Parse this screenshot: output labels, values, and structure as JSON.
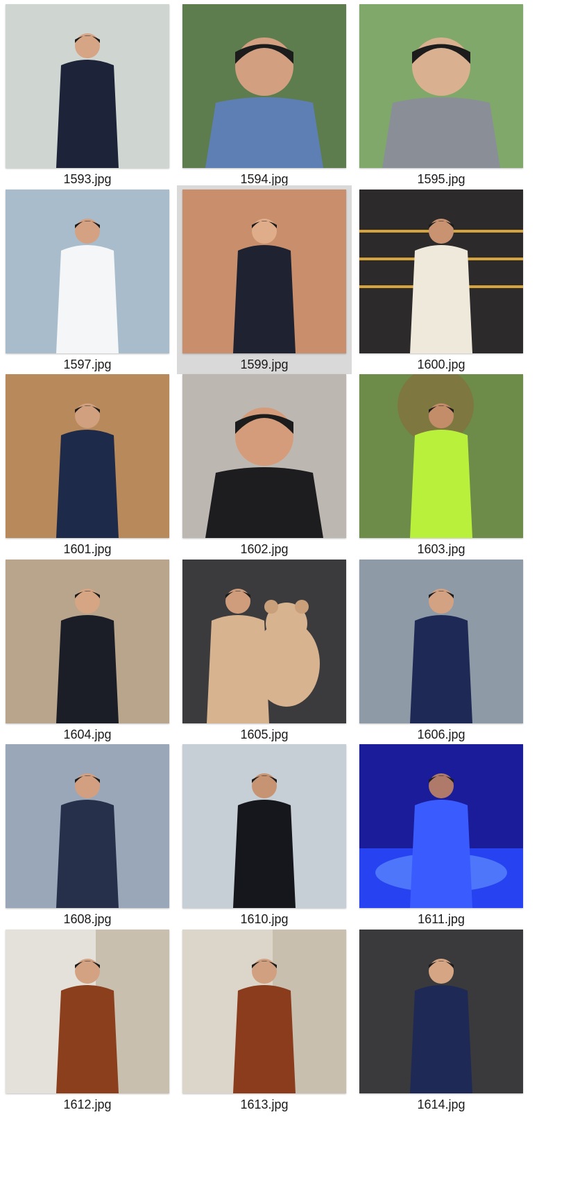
{
  "files": [
    {
      "name": "1593.jpg",
      "scene": "lounge-suit",
      "bg": "#cfd6d2",
      "accent": "#1d2338",
      "skin": "#d6a585"
    },
    {
      "name": "1594.jpg",
      "scene": "closeup-blue-tee",
      "bg": "#5e7d4f",
      "accent": "#5d7fb3",
      "skin": "#d2a080"
    },
    {
      "name": "1595.jpg",
      "scene": "selfie-trees",
      "bg": "#7fa86a",
      "accent": "#8a8f97",
      "skin": "#d9b090"
    },
    {
      "name": "1597.jpg",
      "scene": "white-shirt",
      "bg": "#a9bccc",
      "accent": "#f4f6f8",
      "skin": "#d4a182"
    },
    {
      "name": "1599.jpg",
      "scene": "suit-stripe-tie",
      "bg": "#c98f6c",
      "accent": "#1f2230",
      "skin": "#e0ad8a"
    },
    {
      "name": "1600.jpg",
      "scene": "gold-balcony",
      "bg": "#2c2a2a",
      "accent": "#efe9dc",
      "skin": "#c99372"
    },
    {
      "name": "1601.jpg",
      "scene": "red-chair",
      "bg": "#b8895a",
      "accent": "#1e2a4a",
      "skin": "#d1a07f"
    },
    {
      "name": "1602.jpg",
      "scene": "looking-up",
      "bg": "#bdb7b2",
      "accent": "#1d1d1f",
      "skin": "#d49c7a"
    },
    {
      "name": "1603.jpg",
      "scene": "garden-hivis",
      "bg": "#6d8c4a",
      "accent": "#b8f03c",
      "skin": "#c48d6a"
    },
    {
      "name": "1604.jpg",
      "scene": "hotel-corridor",
      "bg": "#b9a48c",
      "accent": "#1b1e27",
      "skin": "#d6a584"
    },
    {
      "name": "1605.jpg",
      "scene": "car-teddy",
      "bg": "#3b3b3e",
      "accent": "#d7b38f",
      "skin": "#cf9d7c"
    },
    {
      "name": "1606.jpg",
      "scene": "mirror-bathroom",
      "bg": "#8e9aa6",
      "accent": "#1e2a55",
      "skin": "#d3a283"
    },
    {
      "name": "1608.jpg",
      "scene": "harbour",
      "bg": "#9aa7b8",
      "accent": "#26304a",
      "skin": "#d2a080"
    },
    {
      "name": "1610.jpg",
      "scene": "balcony-view",
      "bg": "#c7cfd6",
      "accent": "#15171d",
      "skin": "#c79473"
    },
    {
      "name": "1611.jpg",
      "scene": "blue-spa",
      "bg": "#1a1c9a",
      "accent": "#3a5cff",
      "skin": "#b07a6a"
    },
    {
      "name": "1612.jpg",
      "scene": "stone-wall",
      "bg": "#e4e1da",
      "accent": "#8b3f1c",
      "skin": "#d3a283"
    },
    {
      "name": "1613.jpg",
      "scene": "stone-wall-2",
      "bg": "#dcd6ca",
      "accent": "#8a3c1d",
      "skin": "#d0a080"
    },
    {
      "name": "1614.jpg",
      "scene": "hotel-bed",
      "bg": "#3a3a3d",
      "accent": "#1e2a55",
      "skin": "#d6a584"
    }
  ],
  "selected_index": 4
}
